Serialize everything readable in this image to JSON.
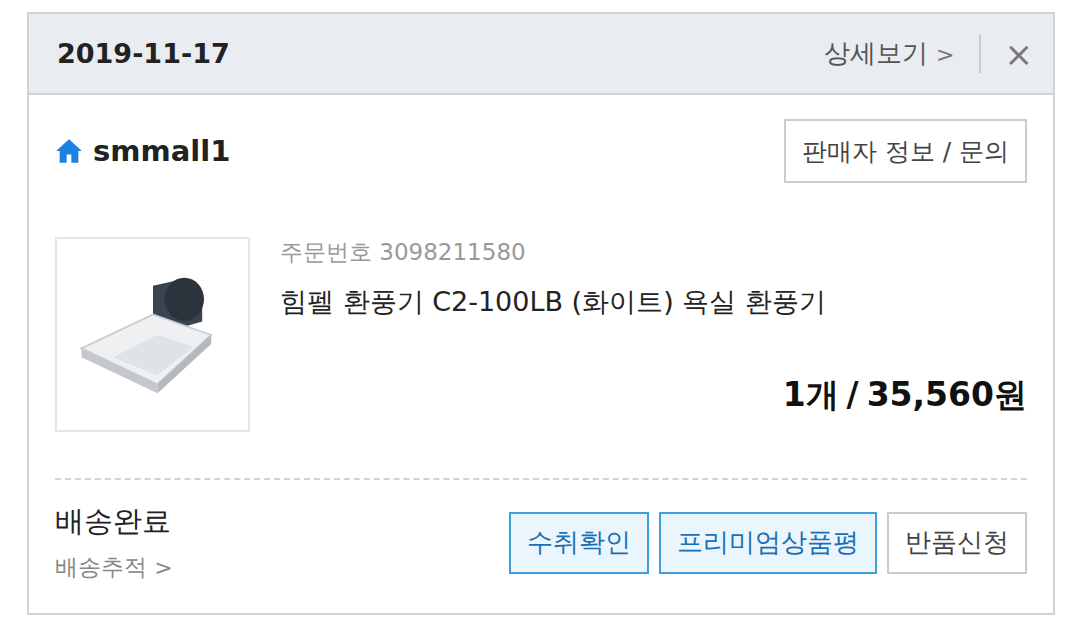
{
  "header": {
    "date": "2019-11-17",
    "detail_link": "상세보기",
    "detail_chevron": ">",
    "close": "×"
  },
  "seller": {
    "name": "smmall1",
    "info_button": "판매자 정보 / 문의"
  },
  "order": {
    "number_label": "주문번호",
    "number": "3098211580",
    "product": "힘펠 환풍기 C2-100LB (화이트) 욕실 환풍기",
    "quantity": "1개",
    "separator": "/",
    "price": "35,560원"
  },
  "delivery": {
    "status": "배송완료",
    "tracking_link": "배송추적",
    "tracking_chevron": ">"
  },
  "buttons": [
    {
      "label": "수취확인",
      "kind": "primary"
    },
    {
      "label": "프리미엄상품평",
      "kind": "primary"
    },
    {
      "label": "반품신청",
      "kind": "secondary"
    }
  ]
}
